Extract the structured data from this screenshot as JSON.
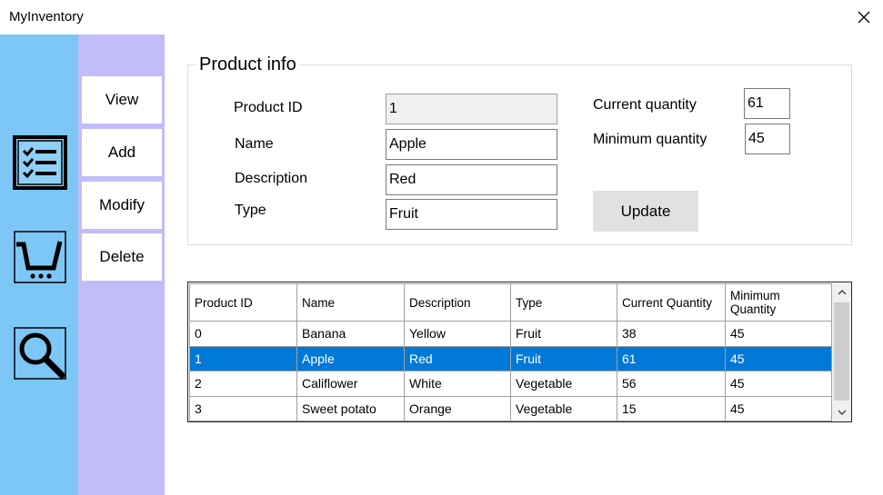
{
  "window": {
    "title": "MyInventory"
  },
  "icons": {
    "close": "close-icon",
    "list": "checklist-icon",
    "cart": "shopping-cart-icon",
    "search": "magnifier-icon"
  },
  "colors": {
    "icon_rail": "#7dc7f6",
    "menu_column": "#c2bcf9",
    "selection": "#0078d7"
  },
  "menu": {
    "view_label": "View",
    "add_label": "Add",
    "modify_label": "Modify",
    "delete_label": "Delete"
  },
  "product_info": {
    "title": "Product info",
    "product_id_label": "Product ID",
    "product_id_value": "1",
    "name_label": "Name",
    "name_value": "Apple",
    "description_label": "Description",
    "description_value": "Red",
    "type_label": "Type",
    "type_value": "Fruit",
    "current_quantity_label": "Current quantity",
    "current_quantity_value": "61",
    "minimum_quantity_label": "Minimum quantity",
    "minimum_quantity_value": "45",
    "update_label": "Update"
  },
  "table": {
    "columns": [
      "Product ID",
      "Name",
      "Description",
      "Type",
      "Current Quantity",
      "Minimum Quantity"
    ],
    "rows": [
      [
        "0",
        "Banana",
        "Yellow",
        "Fruit",
        "38",
        "45"
      ],
      [
        "1",
        "Apple",
        "Red",
        "Fruit",
        "61",
        "45"
      ],
      [
        "2",
        "Califlower",
        "White",
        "Vegetable",
        "56",
        "45"
      ],
      [
        "3",
        "Sweet potato",
        "Orange",
        "Vegetable",
        "15",
        "45"
      ]
    ],
    "selected_row": 1
  }
}
